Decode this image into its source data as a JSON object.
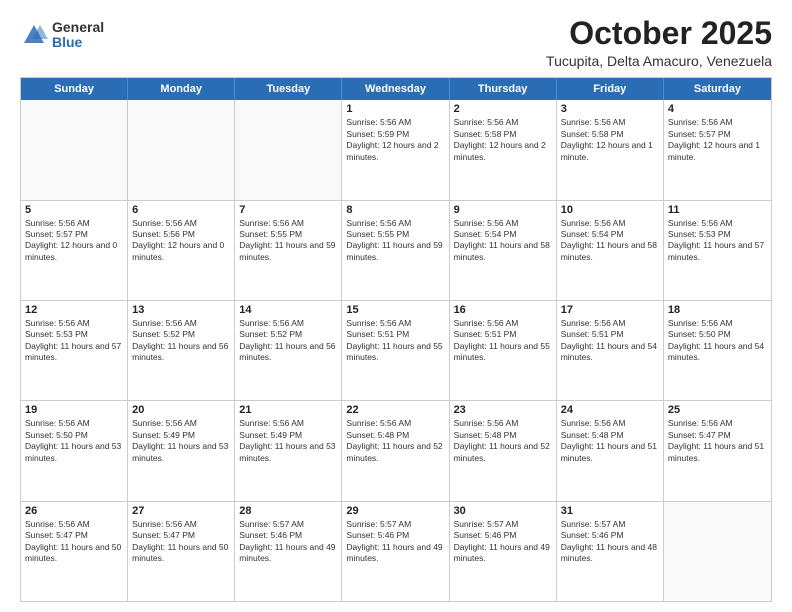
{
  "logo": {
    "general": "General",
    "blue": "Blue"
  },
  "title": "October 2025",
  "location": "Tucupita, Delta Amacuro, Venezuela",
  "header": {
    "days": [
      "Sunday",
      "Monday",
      "Tuesday",
      "Wednesday",
      "Thursday",
      "Friday",
      "Saturday"
    ]
  },
  "weeks": [
    [
      {
        "day": "",
        "text": ""
      },
      {
        "day": "",
        "text": ""
      },
      {
        "day": "",
        "text": ""
      },
      {
        "day": "1",
        "text": "Sunrise: 5:56 AM\nSunset: 5:59 PM\nDaylight: 12 hours and 2 minutes."
      },
      {
        "day": "2",
        "text": "Sunrise: 5:56 AM\nSunset: 5:58 PM\nDaylight: 12 hours and 2 minutes."
      },
      {
        "day": "3",
        "text": "Sunrise: 5:56 AM\nSunset: 5:58 PM\nDaylight: 12 hours and 1 minute."
      },
      {
        "day": "4",
        "text": "Sunrise: 5:56 AM\nSunset: 5:57 PM\nDaylight: 12 hours and 1 minute."
      }
    ],
    [
      {
        "day": "5",
        "text": "Sunrise: 5:56 AM\nSunset: 5:57 PM\nDaylight: 12 hours and 0 minutes."
      },
      {
        "day": "6",
        "text": "Sunrise: 5:56 AM\nSunset: 5:56 PM\nDaylight: 12 hours and 0 minutes."
      },
      {
        "day": "7",
        "text": "Sunrise: 5:56 AM\nSunset: 5:55 PM\nDaylight: 11 hours and 59 minutes."
      },
      {
        "day": "8",
        "text": "Sunrise: 5:56 AM\nSunset: 5:55 PM\nDaylight: 11 hours and 59 minutes."
      },
      {
        "day": "9",
        "text": "Sunrise: 5:56 AM\nSunset: 5:54 PM\nDaylight: 11 hours and 58 minutes."
      },
      {
        "day": "10",
        "text": "Sunrise: 5:56 AM\nSunset: 5:54 PM\nDaylight: 11 hours and 58 minutes."
      },
      {
        "day": "11",
        "text": "Sunrise: 5:56 AM\nSunset: 5:53 PM\nDaylight: 11 hours and 57 minutes."
      }
    ],
    [
      {
        "day": "12",
        "text": "Sunrise: 5:56 AM\nSunset: 5:53 PM\nDaylight: 11 hours and 57 minutes."
      },
      {
        "day": "13",
        "text": "Sunrise: 5:56 AM\nSunset: 5:52 PM\nDaylight: 11 hours and 56 minutes."
      },
      {
        "day": "14",
        "text": "Sunrise: 5:56 AM\nSunset: 5:52 PM\nDaylight: 11 hours and 56 minutes."
      },
      {
        "day": "15",
        "text": "Sunrise: 5:56 AM\nSunset: 5:51 PM\nDaylight: 11 hours and 55 minutes."
      },
      {
        "day": "16",
        "text": "Sunrise: 5:56 AM\nSunset: 5:51 PM\nDaylight: 11 hours and 55 minutes."
      },
      {
        "day": "17",
        "text": "Sunrise: 5:56 AM\nSunset: 5:51 PM\nDaylight: 11 hours and 54 minutes."
      },
      {
        "day": "18",
        "text": "Sunrise: 5:56 AM\nSunset: 5:50 PM\nDaylight: 11 hours and 54 minutes."
      }
    ],
    [
      {
        "day": "19",
        "text": "Sunrise: 5:56 AM\nSunset: 5:50 PM\nDaylight: 11 hours and 53 minutes."
      },
      {
        "day": "20",
        "text": "Sunrise: 5:56 AM\nSunset: 5:49 PM\nDaylight: 11 hours and 53 minutes."
      },
      {
        "day": "21",
        "text": "Sunrise: 5:56 AM\nSunset: 5:49 PM\nDaylight: 11 hours and 53 minutes."
      },
      {
        "day": "22",
        "text": "Sunrise: 5:56 AM\nSunset: 5:48 PM\nDaylight: 11 hours and 52 minutes."
      },
      {
        "day": "23",
        "text": "Sunrise: 5:56 AM\nSunset: 5:48 PM\nDaylight: 11 hours and 52 minutes."
      },
      {
        "day": "24",
        "text": "Sunrise: 5:56 AM\nSunset: 5:48 PM\nDaylight: 11 hours and 51 minutes."
      },
      {
        "day": "25",
        "text": "Sunrise: 5:56 AM\nSunset: 5:47 PM\nDaylight: 11 hours and 51 minutes."
      }
    ],
    [
      {
        "day": "26",
        "text": "Sunrise: 5:56 AM\nSunset: 5:47 PM\nDaylight: 11 hours and 50 minutes."
      },
      {
        "day": "27",
        "text": "Sunrise: 5:56 AM\nSunset: 5:47 PM\nDaylight: 11 hours and 50 minutes."
      },
      {
        "day": "28",
        "text": "Sunrise: 5:57 AM\nSunset: 5:46 PM\nDaylight: 11 hours and 49 minutes."
      },
      {
        "day": "29",
        "text": "Sunrise: 5:57 AM\nSunset: 5:46 PM\nDaylight: 11 hours and 49 minutes."
      },
      {
        "day": "30",
        "text": "Sunrise: 5:57 AM\nSunset: 5:46 PM\nDaylight: 11 hours and 49 minutes."
      },
      {
        "day": "31",
        "text": "Sunrise: 5:57 AM\nSunset: 5:46 PM\nDaylight: 11 hours and 48 minutes."
      },
      {
        "day": "",
        "text": ""
      }
    ]
  ]
}
